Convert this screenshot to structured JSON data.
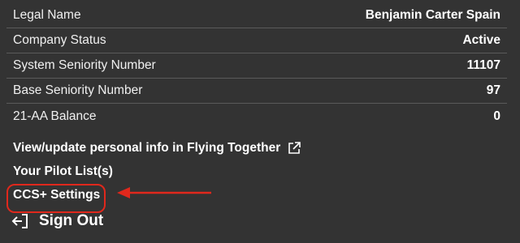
{
  "profile": {
    "rows": [
      {
        "label": "Legal Name",
        "value": "Benjamin Carter Spain"
      },
      {
        "label": "Company Status",
        "value": "Active"
      },
      {
        "label": "System Seniority Number",
        "value": "11107"
      },
      {
        "label": "Base Seniority Number",
        "value": "97"
      },
      {
        "label": "21-AA Balance",
        "value": "0"
      }
    ]
  },
  "links": {
    "personal_info": "View/update personal info in Flying Together",
    "pilot_list": "Your Pilot List(s)",
    "ccs_settings": "CCS+ Settings",
    "sign_out": "Sign Out"
  },
  "icons": {
    "external_link": "external-link-icon",
    "sign_out": "sign-out-icon",
    "annotation_arrow": "arrow-left-icon"
  },
  "colors": {
    "background": "#333333",
    "annotation": "#e0281c"
  }
}
